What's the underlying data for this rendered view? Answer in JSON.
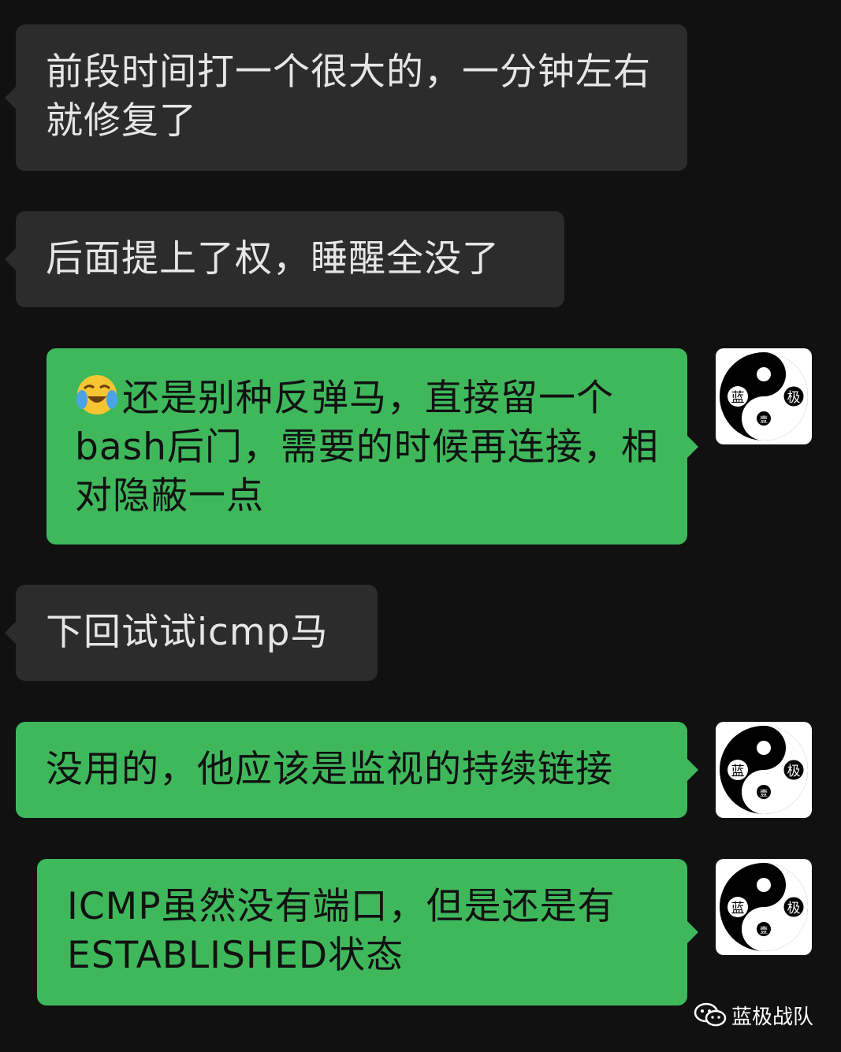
{
  "messages": [
    {
      "direction": "in",
      "text": "前段时间打一个很大的，一分钟左右就修复了"
    },
    {
      "direction": "in",
      "text": "后面提上了权，睡醒全没了"
    },
    {
      "direction": "out",
      "emoji": "crying-face-emoji",
      "text": "还是别种反弹马，直接留一个bash后门，需要的时候再连接，相对隐蔽一点"
    },
    {
      "direction": "in",
      "text": "下回试试icmp马"
    },
    {
      "direction": "out",
      "text": "没用的，他应该是监视的持续链接"
    },
    {
      "direction": "out",
      "text": "ICMP虽然没有端口，但是还是有ESTABLISHED状态"
    }
  ],
  "avatar": {
    "char_left": "蓝",
    "char_right": "极",
    "char_bottom": "壹"
  },
  "watermark": {
    "text": "蓝极战队",
    "icon": "wechat-icon"
  },
  "colors": {
    "background": "#111111",
    "incoming": "#2c2c2c",
    "outgoing": "#3fb85c"
  }
}
